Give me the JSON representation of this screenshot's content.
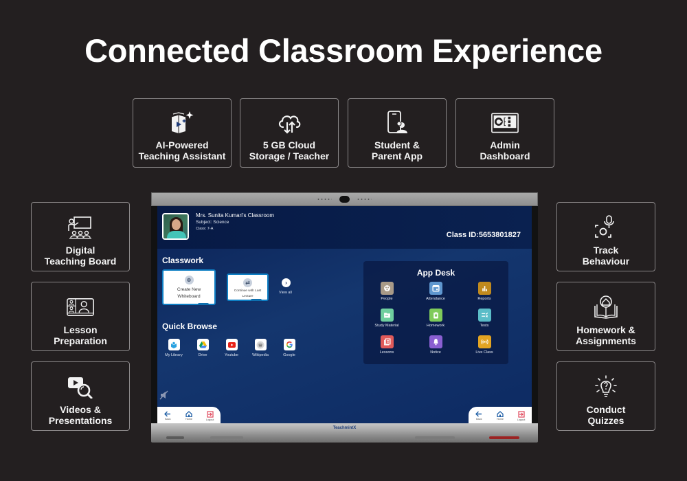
{
  "page": {
    "title": "Connected Classroom Experience"
  },
  "features": {
    "top": [
      {
        "label": "AI-Powered\nTeaching Assistant",
        "icon": "ai-book-sparkle-icon"
      },
      {
        "label": "5 GB Cloud\nStorage / Teacher",
        "icon": "cloud-sync-icon"
      },
      {
        "label": "Student &\nParent App",
        "icon": "mobile-user-icon"
      },
      {
        "label": "Admin\nDashboard",
        "icon": "dashboard-icon"
      }
    ],
    "left": [
      {
        "label": "Digital\nTeaching Board",
        "icon": "teaching-board-icon"
      },
      {
        "label": "Lesson\nPreparation",
        "icon": "video-lesson-icon"
      },
      {
        "label": "Videos &\nPresentations",
        "icon": "video-search-icon"
      }
    ],
    "right": [
      {
        "label": "Track\nBehaviour",
        "icon": "track-behaviour-icon"
      },
      {
        "label": "Homework &\nAssignments",
        "icon": "homework-book-icon"
      },
      {
        "label": "Conduct\nQuizzes",
        "icon": "quiz-bulb-icon"
      }
    ]
  },
  "board": {
    "teacher": {
      "name": "Mrs. Sunita Kumari's Classroom",
      "subject": "Subject: Science",
      "class": "Class: 7-A"
    },
    "class_id": "Class ID:5653801827",
    "classwork": {
      "title": "Classwork",
      "cards": [
        {
          "label": "Create New Whiteboard",
          "icon": "plus-circle-icon"
        },
        {
          "label": "Continue with Last Lecture",
          "icon": "repeat-icon"
        }
      ],
      "view_all": "View all"
    },
    "quick_browse": {
      "title": "Quick Browse",
      "items": [
        {
          "label": "My Library",
          "icon": "library-icon"
        },
        {
          "label": "Drive",
          "icon": "drive-icon"
        },
        {
          "label": "Youtube",
          "icon": "youtube-icon"
        },
        {
          "label": "Wikipedia",
          "icon": "wikipedia-icon"
        },
        {
          "label": "Google",
          "icon": "google-icon"
        }
      ]
    },
    "app_desk": {
      "title": "App Desk",
      "apps": [
        {
          "label": "People",
          "icon": "people-icon",
          "color": "#a89a88"
        },
        {
          "label": "Attendance",
          "icon": "calendar-icon",
          "color": "#5f97cf"
        },
        {
          "label": "Reports",
          "icon": "bar-chart-icon",
          "color": "#c08a1e"
        },
        {
          "label": "Study Material",
          "icon": "folder-icon",
          "color": "#6fcf9f"
        },
        {
          "label": "Homework",
          "icon": "clipboard-icon",
          "color": "#7fcb5a"
        },
        {
          "label": "Tests",
          "icon": "checklist-icon",
          "color": "#5bbdc8"
        },
        {
          "label": "Lessons",
          "icon": "lessons-icon",
          "color": "#e05a5a"
        },
        {
          "label": "Notice",
          "icon": "bell-icon",
          "color": "#8a5fd1"
        },
        {
          "label": "Live Class",
          "icon": "broadcast-icon",
          "color": "#e3a422"
        }
      ]
    },
    "nav": {
      "back": "Back",
      "home": "Home",
      "logout": "Logout"
    },
    "brand": "TeachmintX"
  }
}
